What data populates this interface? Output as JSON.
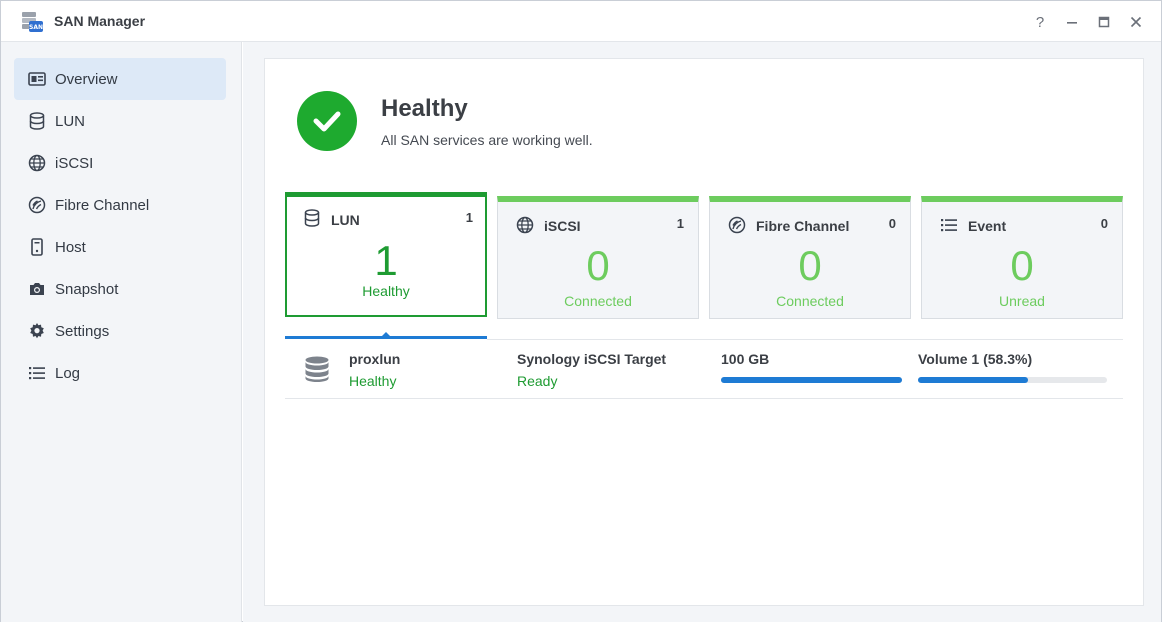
{
  "window": {
    "title": "SAN Manager",
    "app_icon_text": "SAN",
    "help_label": "?"
  },
  "sidebar": {
    "items": [
      {
        "label": "Overview",
        "icon": "overview-icon",
        "active": true
      },
      {
        "label": "LUN",
        "icon": "database-icon"
      },
      {
        "label": "iSCSI",
        "icon": "globe-icon"
      },
      {
        "label": "Fibre Channel",
        "icon": "fibre-channel-icon"
      },
      {
        "label": "Host",
        "icon": "host-icon"
      },
      {
        "label": "Snapshot",
        "icon": "camera-icon"
      },
      {
        "label": "Settings",
        "icon": "gear-icon"
      },
      {
        "label": "Log",
        "icon": "list-icon"
      }
    ]
  },
  "status": {
    "title": "Healthy",
    "subtitle": "All SAN services are working well.",
    "color": "#1eaa2f"
  },
  "cards": [
    {
      "name": "LUN",
      "count": "1",
      "value": "1",
      "state": "Healthy",
      "icon": "database-icon",
      "selected": true
    },
    {
      "name": "iSCSI",
      "count": "1",
      "value": "0",
      "state": "Connected",
      "icon": "globe-icon"
    },
    {
      "name": "Fibre Channel",
      "count": "0",
      "value": "0",
      "state": "Connected",
      "icon": "fibre-channel-icon"
    },
    {
      "name": "Event",
      "count": "0",
      "value": "0",
      "state": "Unread",
      "icon": "list-icon"
    }
  ],
  "lun_list": [
    {
      "name": "proxlun",
      "status": "Healthy",
      "target": "Synology iSCSI Target",
      "target_status": "Ready",
      "size": "100 GB",
      "size_fill": 1.0,
      "volume": "Volume 1 (58.3%)",
      "volume_fill": 0.583
    }
  ],
  "colors": {
    "accent_blue": "#1e7bd4",
    "healthy_green": "#1e9b32",
    "light_green": "#6dcc5e"
  }
}
